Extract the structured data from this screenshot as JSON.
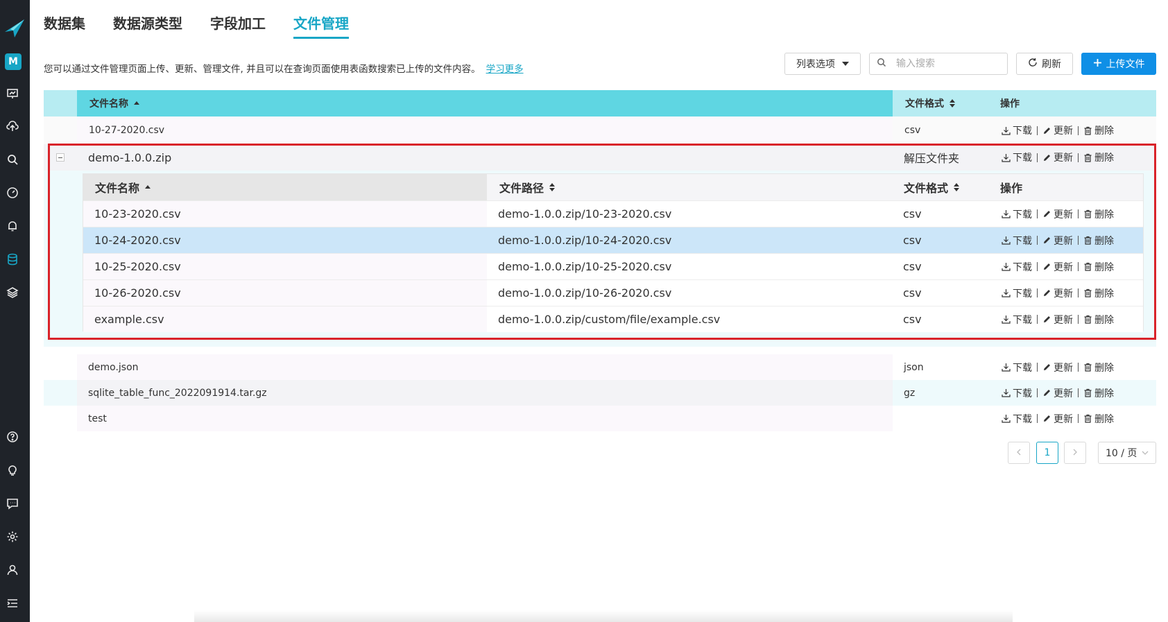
{
  "sidebar": {
    "avatar_letter": "M",
    "icons": [
      "presentation-icon",
      "upload-cloud-icon",
      "search-icon",
      "dashboard-icon",
      "bell-icon",
      "database-icon",
      "layers-icon",
      "help-icon",
      "lightbulb-icon",
      "chat-icon",
      "gear-icon",
      "user-icon",
      "menu-collapse-icon"
    ],
    "active_icon": "database-icon",
    "accent": "#18a6c6"
  },
  "tabs": [
    {
      "label": "数据集"
    },
    {
      "label": "数据源类型"
    },
    {
      "label": "字段加工"
    },
    {
      "label": "文件管理",
      "active": true
    }
  ],
  "description": "您可以通过文件管理页面上传、更新、管理文件, 并且可以在查询页面使用表函数搜索已上传的文件内容。",
  "learn_more": "学习更多",
  "toolbar": {
    "columns_label": "列表选项",
    "search_placeholder": "输入搜索",
    "refresh_label": "刷新",
    "upload_label": "上传文件"
  },
  "table": {
    "headers": {
      "name": "文件名称",
      "format": "文件格式",
      "actions": "操作"
    },
    "rows": [
      {
        "name": "10-27-2020.csv",
        "format": "csv"
      },
      {
        "name": "demo-1.0.0.zip",
        "format": "解压文件夹",
        "expanded": true
      },
      {
        "name": "demo.json",
        "format": "json"
      },
      {
        "name": "sqlite_table_func_2022091914.tar.gz",
        "format": "gz"
      },
      {
        "name": "test",
        "format": ""
      }
    ],
    "actions": {
      "download": "下载",
      "update": "更新",
      "delete": "删除"
    }
  },
  "subtable": {
    "headers": {
      "name": "文件名称",
      "path": "文件路径",
      "format": "文件格式",
      "actions": "操作"
    },
    "rows": [
      {
        "name": "10-23-2020.csv",
        "path": "demo-1.0.0.zip/10-23-2020.csv",
        "format": "csv"
      },
      {
        "name": "10-24-2020.csv",
        "path": "demo-1.0.0.zip/10-24-2020.csv",
        "format": "csv",
        "selected": true
      },
      {
        "name": "10-25-2020.csv",
        "path": "demo-1.0.0.zip/10-25-2020.csv",
        "format": "csv"
      },
      {
        "name": "10-26-2020.csv",
        "path": "demo-1.0.0.zip/10-26-2020.csv",
        "format": "csv"
      },
      {
        "name": "example.csv",
        "path": "demo-1.0.0.zip/custom/file/example.csv",
        "format": "csv"
      }
    ]
  },
  "pagination": {
    "current": "1",
    "page_size": "10 / 页"
  },
  "colors": {
    "accent": "#18a6c6",
    "primary_button": "#0f8fe6",
    "header_bg": "#5fd6e2",
    "highlight_border": "#d9232a",
    "selected_row": "#cce6f9"
  }
}
